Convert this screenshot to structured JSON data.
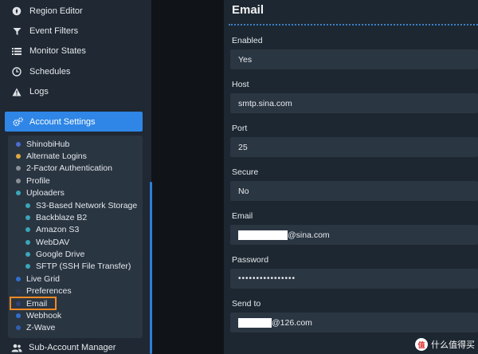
{
  "sidebar": {
    "top_items": [
      {
        "label": "Region Editor",
        "icon": "compass-icon"
      },
      {
        "label": "Event Filters",
        "icon": "filter-icon"
      },
      {
        "label": "Monitor States",
        "icon": "list-icon"
      },
      {
        "label": "Schedules",
        "icon": "clock-icon"
      },
      {
        "label": "Logs",
        "icon": "warning-icon"
      }
    ],
    "account_settings": {
      "label": "Account Settings",
      "icon": "gears-icon"
    },
    "sub_items": [
      {
        "label": "ShinobiHub",
        "color": "#4a6cd4"
      },
      {
        "label": "Alternate Logins",
        "color": "#e0a843"
      },
      {
        "label": "2-Factor Authentication",
        "color": "#8a8f96"
      },
      {
        "label": "Profile",
        "color": "#8a8f96"
      },
      {
        "label": "Uploaders",
        "color": "#3aa6b9"
      },
      {
        "label": "S3-Based Network Storage",
        "color": "#3aa6b9"
      },
      {
        "label": "Backblaze B2",
        "color": "#3aa6b9"
      },
      {
        "label": "Amazon S3",
        "color": "#3aa6b9"
      },
      {
        "label": "WebDAV",
        "color": "#3aa6b9"
      },
      {
        "label": "Google Drive",
        "color": "#3aa6b9"
      },
      {
        "label": "SFTP (SSH File Transfer)",
        "color": "#3aa6b9"
      },
      {
        "label": "Live Grid",
        "color": "#2f6fd0"
      },
      {
        "label": "Preferences",
        "color": "#2d3a55"
      },
      {
        "label": "Email",
        "color": "#33427a"
      },
      {
        "label": "Webhook",
        "color": "#2f6fd0"
      },
      {
        "label": "Z-Wave",
        "color": "#2f5fb0"
      }
    ],
    "sub_account": {
      "label": "Sub-Account Manager",
      "icon": "users-icon"
    }
  },
  "form": {
    "title": "Email",
    "fields": {
      "enabled": {
        "label": "Enabled",
        "value": "Yes"
      },
      "host": {
        "label": "Host",
        "value": "smtp.sina.com"
      },
      "port": {
        "label": "Port",
        "value": "25"
      },
      "secure": {
        "label": "Secure",
        "value": "No"
      },
      "email": {
        "label": "Email",
        "value_suffix": "@sina.com"
      },
      "password": {
        "label": "Password",
        "value": "••••••••••••••••"
      },
      "send_to": {
        "label": "Send to",
        "value_suffix": "@126.com"
      }
    }
  },
  "watermark": {
    "badge": "值",
    "text": "什么值得买"
  }
}
